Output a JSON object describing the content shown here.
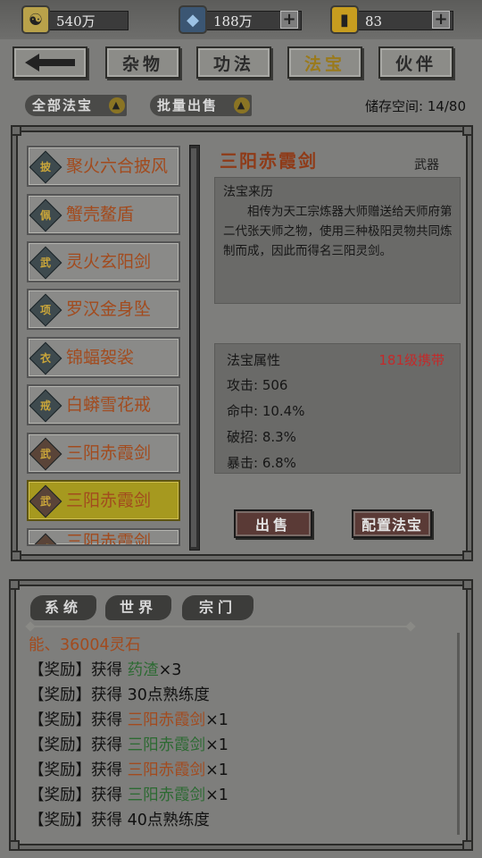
{
  "resources": [
    {
      "icon": "coin-icon",
      "value": "540万",
      "has_plus": false
    },
    {
      "icon": "spirit-stone-icon",
      "value": "188万",
      "has_plus": true
    },
    {
      "icon": "gold-ingot-icon",
      "value": "83",
      "has_plus": true
    }
  ],
  "nav": {
    "back_icon": "back-arrow-icon",
    "tabs": [
      {
        "label": "杂物",
        "active": false
      },
      {
        "label": "功法",
        "active": false
      },
      {
        "label": "法宝",
        "active": true
      },
      {
        "label": "伙伴",
        "active": false
      }
    ]
  },
  "filters": {
    "all": "全部法宝",
    "batch": "批量出售",
    "storage": "储存空间: 14/80"
  },
  "items": [
    {
      "badge": "披",
      "name": "聚火六合披风"
    },
    {
      "badge": "佩",
      "name": "蟹壳鳌盾"
    },
    {
      "badge": "武",
      "name": "灵火玄阳剑"
    },
    {
      "badge": "项",
      "name": "罗汉金身坠"
    },
    {
      "badge": "衣",
      "name": "锦蝠袈裟"
    },
    {
      "badge": "戒",
      "name": "白蟒雪花戒"
    },
    {
      "badge": "武",
      "name": "三阳赤霞剑"
    },
    {
      "badge": "武",
      "name": "三阳赤霞剑",
      "selected": true
    },
    {
      "badge": "武",
      "name": "三阳赤霞剑"
    }
  ],
  "detail": {
    "title": "三阳赤霞剑",
    "type": "武器",
    "origin_label": "法宝来历",
    "origin_text": "相传为天工宗炼器大师赠送给天师府第二代张天师之物，使用三种极阳灵物共同炼制而成，因此而得名三阳灵剑。",
    "attr_label": "法宝属性",
    "level": "181级携带",
    "attrs": [
      "攻击: 506",
      "命中: 10.4%",
      "破招: 8.3%",
      "暴击: 6.8%"
    ],
    "sell": "出售",
    "equip": "配置法宝"
  },
  "chat": {
    "tabs": [
      "系统",
      "世界",
      "宗门"
    ],
    "lines": [
      {
        "prefix": "",
        "verb": "",
        "item": "能、36004灵石",
        "suffix": "",
        "color": "r"
      },
      {
        "prefix": "【奖励】",
        "verb": "获得 ",
        "item": "药渣",
        "suffix": "×3",
        "color": "g"
      },
      {
        "prefix": "【奖励】",
        "verb": "获得 ",
        "item": "30点熟练度",
        "suffix": "",
        "color": ""
      },
      {
        "prefix": "【奖励】",
        "verb": "获得 ",
        "item": "三阳赤霞剑",
        "suffix": "×1",
        "color": "r"
      },
      {
        "prefix": "【奖励】",
        "verb": "获得 ",
        "item": "三阳赤霞剑",
        "suffix": "×1",
        "color": "g"
      },
      {
        "prefix": "【奖励】",
        "verb": "获得 ",
        "item": "三阳赤霞剑",
        "suffix": "×1",
        "color": "r"
      },
      {
        "prefix": "【奖励】",
        "verb": "获得 ",
        "item": "三阳赤霞剑",
        "suffix": "×1",
        "color": "g"
      },
      {
        "prefix": "【奖励】",
        "verb": "获得 ",
        "item": "40点熟练度",
        "suffix": "",
        "color": ""
      }
    ]
  },
  "colors": {
    "item_name": "#a24b1e",
    "level_red": "#c32a2a",
    "reward_green": "#2c6a32",
    "selected_item": "#a6991f"
  }
}
